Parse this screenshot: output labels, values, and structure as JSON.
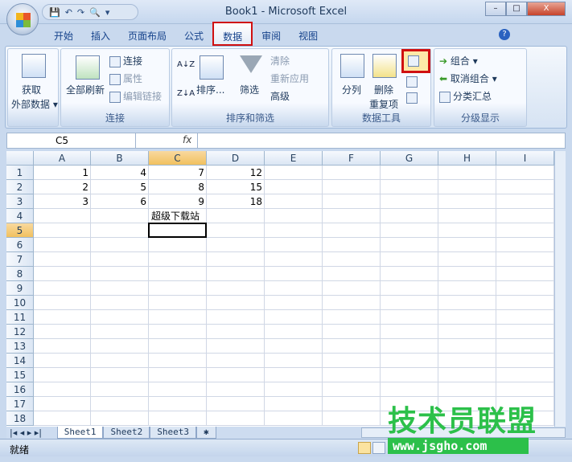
{
  "window": {
    "title": "Book1 - Microsoft Excel",
    "min": "–",
    "max": "□",
    "close": "X"
  },
  "qat": {
    "save": "💾",
    "undo": "↶",
    "redo": "↷",
    "preview": "🔍",
    "more": "▾"
  },
  "tabs": [
    {
      "label": "开始"
    },
    {
      "label": "插入"
    },
    {
      "label": "页面布局"
    },
    {
      "label": "公式"
    },
    {
      "label": "数据",
      "active": true
    },
    {
      "label": "审阅"
    },
    {
      "label": "视图"
    }
  ],
  "ribbon": {
    "get_external": {
      "line1": "获取",
      "line2": "外部数据 ▾"
    },
    "connections": {
      "refresh_all": "全部刷新",
      "connect": "连接",
      "properties": "属性",
      "edit_links": "编辑链接",
      "label": "连接"
    },
    "sort_filter": {
      "sort_az": "A↓Z",
      "sort_za": "Z↓A",
      "sort": "排序...",
      "filter": "筛选",
      "clear": "清除",
      "reapply": "重新应用",
      "advanced": "高级",
      "label": "排序和筛选"
    },
    "data_tools": {
      "text_to_columns": "分列",
      "remove_dup_1": "删除",
      "remove_dup_2": "重复项",
      "label": "数据工具"
    },
    "outline": {
      "group": "组合 ▾",
      "ungroup": "取消组合 ▾",
      "subtotal": "分类汇总",
      "label": "分级显示"
    },
    "highlight_color": "#d01010"
  },
  "formula_bar": {
    "name_box": "C5",
    "fx": "fx",
    "value": ""
  },
  "columns": [
    "A",
    "B",
    "C",
    "D",
    "E",
    "F",
    "G",
    "H",
    "I"
  ],
  "rows": [
    "1",
    "2",
    "3",
    "4",
    "5",
    "6",
    "7",
    "8",
    "9",
    "10",
    "11",
    "12",
    "13",
    "14",
    "15",
    "16",
    "17",
    "18"
  ],
  "cells": [
    {
      "r": 0,
      "c": 0,
      "v": "1"
    },
    {
      "r": 0,
      "c": 1,
      "v": "4"
    },
    {
      "r": 0,
      "c": 2,
      "v": "7"
    },
    {
      "r": 0,
      "c": 3,
      "v": "12"
    },
    {
      "r": 1,
      "c": 0,
      "v": "2"
    },
    {
      "r": 1,
      "c": 1,
      "v": "5"
    },
    {
      "r": 1,
      "c": 2,
      "v": "8"
    },
    {
      "r": 1,
      "c": 3,
      "v": "15"
    },
    {
      "r": 2,
      "c": 0,
      "v": "3"
    },
    {
      "r": 2,
      "c": 1,
      "v": "6"
    },
    {
      "r": 2,
      "c": 2,
      "v": "9"
    },
    {
      "r": 2,
      "c": 3,
      "v": "18"
    },
    {
      "r": 3,
      "c": 2,
      "v": "超级下载站",
      "text": true
    }
  ],
  "selected": {
    "r": 4,
    "c": 2
  },
  "sheets": [
    "Sheet1",
    "Sheet2",
    "Sheet3"
  ],
  "status": {
    "ready": "就绪"
  },
  "watermark": {
    "line1": "技术员联盟",
    "line2": "www.jsgho.com"
  }
}
